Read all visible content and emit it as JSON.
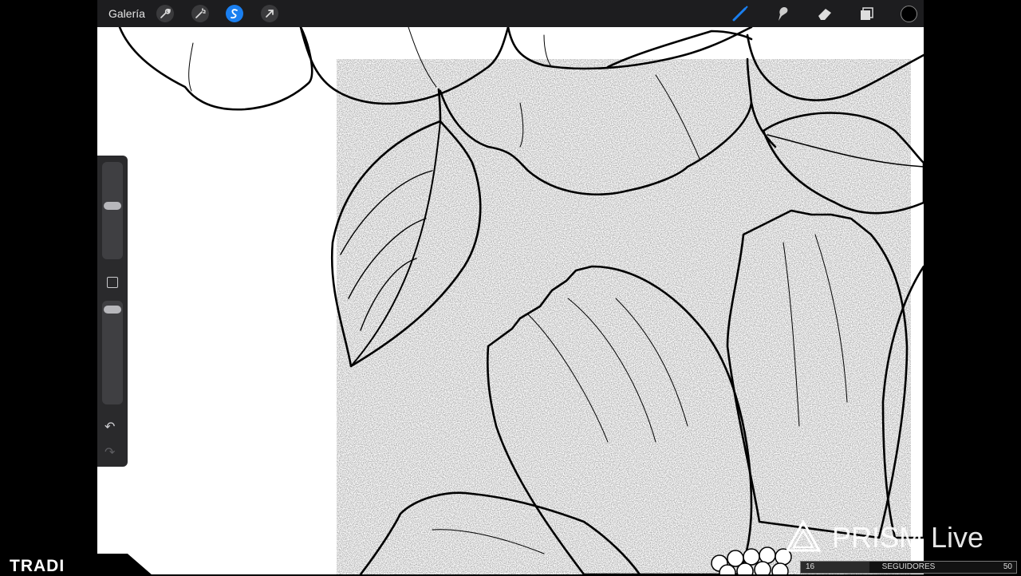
{
  "topbar": {
    "gallery_label": "Galería",
    "left_tools": [
      {
        "icon": "wrench-icon"
      },
      {
        "icon": "magic-wand-icon"
      },
      {
        "icon": "selection-icon",
        "active": true
      },
      {
        "icon": "transform-arrow-icon"
      }
    ],
    "right_tools": [
      {
        "icon": "brush-icon",
        "active": true
      },
      {
        "icon": "smudge-icon"
      },
      {
        "icon": "eraser-icon"
      },
      {
        "icon": "layers-icon"
      },
      {
        "icon": "color-swatch-icon",
        "color": "#000000"
      }
    ]
  },
  "sidebar": {
    "brush_size_level": 0.55,
    "opacity_level": 0.95,
    "undo_icon": "undo-icon",
    "redo_icon": "redo-icon"
  },
  "overlay": {
    "channel_label": "TRADI",
    "stream_brand": "PRISM Live",
    "followers": {
      "current": "16",
      "label": "SEGUIDORES",
      "goal": "50",
      "progress": 0.32
    }
  },
  "colors": {
    "accent": "#1a7ff0",
    "toolbar_bg": "#1d1d1f"
  }
}
